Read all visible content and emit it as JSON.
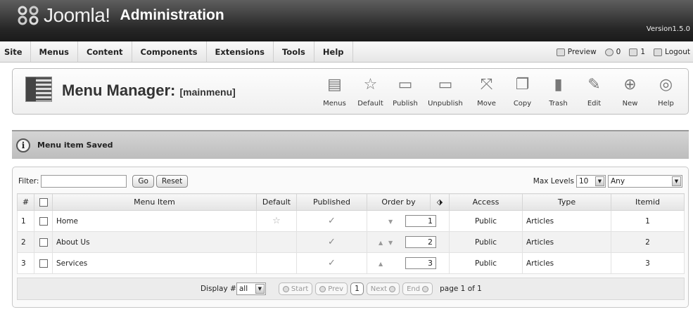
{
  "header": {
    "logo_text": "Joomla!",
    "admin_text": "Administration",
    "version": "Version1.5.0"
  },
  "menu": [
    "Site",
    "Menus",
    "Content",
    "Components",
    "Extensions",
    "Tools",
    "Help"
  ],
  "status": {
    "preview": "Preview",
    "messages": "0",
    "users": "1",
    "logout": "Logout"
  },
  "toolbar": {
    "title": "Menu Manager:",
    "subtitle": "[mainmenu]",
    "buttons": [
      {
        "label": "Menus",
        "icon": "menus-icon"
      },
      {
        "label": "Default",
        "icon": "star-icon"
      },
      {
        "label": "Publish",
        "icon": "publish-icon"
      },
      {
        "label": "Unpublish",
        "icon": "unpublish-icon"
      },
      {
        "label": "Move",
        "icon": "move-icon"
      },
      {
        "label": "Copy",
        "icon": "copy-icon"
      },
      {
        "label": "Trash",
        "icon": "trash-icon"
      },
      {
        "label": "Edit",
        "icon": "edit-icon"
      },
      {
        "label": "New",
        "icon": "new-icon"
      },
      {
        "label": "Help",
        "icon": "help-icon"
      }
    ]
  },
  "message": "Menu item Saved",
  "filter": {
    "label": "Filter:",
    "value": "",
    "go": "Go",
    "reset": "Reset"
  },
  "levels": {
    "label": "Max Levels",
    "value": "10",
    "access": "Any"
  },
  "table": {
    "headers": [
      "#",
      "",
      "Menu Item",
      "Default",
      "Published",
      "Order by",
      "",
      "Access",
      "Type",
      "Itemid"
    ],
    "rows": [
      {
        "num": "1",
        "name": "Home",
        "default": true,
        "order": "1",
        "access": "Public",
        "type": "Articles",
        "itemid": "1"
      },
      {
        "num": "2",
        "name": "About Us",
        "default": false,
        "order": "2",
        "access": "Public",
        "type": "Articles",
        "itemid": "2"
      },
      {
        "num": "3",
        "name": "Services",
        "default": false,
        "order": "3",
        "access": "Public",
        "type": "Articles",
        "itemid": "3"
      }
    ]
  },
  "pager": {
    "display_label": "Display #",
    "display_value": "all",
    "start": "Start",
    "prev": "Prev",
    "page": "1",
    "next": "Next",
    "end": "End",
    "info": "page 1 of 1"
  }
}
